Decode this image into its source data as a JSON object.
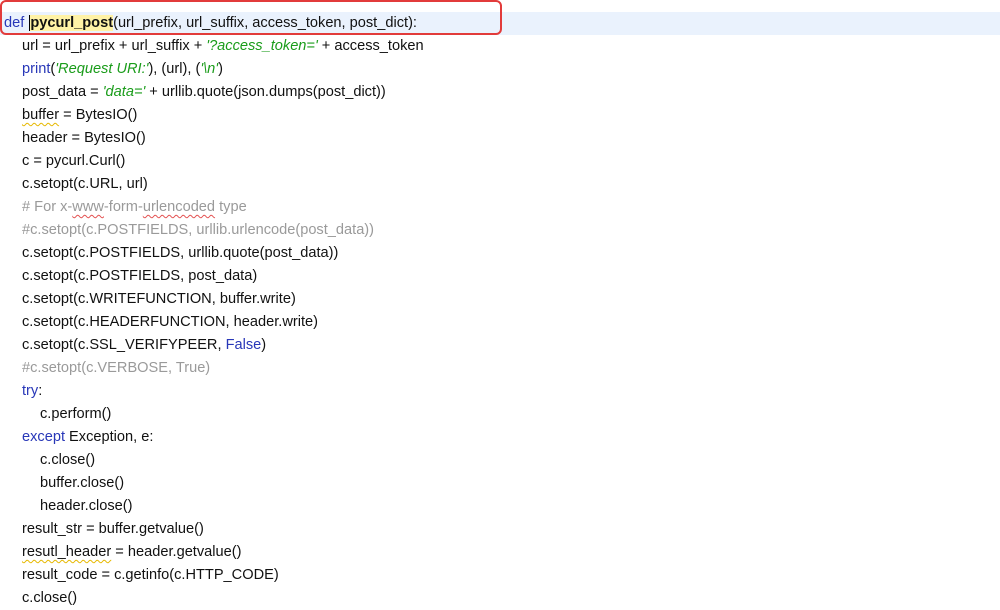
{
  "editor": {
    "language": "python",
    "colors": {
      "keyword": "#2837b8",
      "string": "#1a9c1a",
      "comment": "#9a9a9a",
      "current_line_bg": "#eaf2fd",
      "symbol_highlight": "#fff2a6",
      "annotation_box": "#e23b3b",
      "spell_warning": "#e6b800",
      "spell_error": "#e35050"
    },
    "lines": [
      {
        "indent": 0,
        "kw": "def",
        "fname": "pycurl_post",
        "rest": "(url_prefix, url_suffix, access_token, post_dict):"
      },
      {
        "indent": 1,
        "a": "url = url_prefix + url_suffix + ",
        "str": "'?access_token='",
        "b": " + access_token"
      },
      {
        "indent": 1,
        "kw": "print",
        "a": "(",
        "str": "'Request URI:'",
        "b": "), (url), (",
        "str2": "'\\n'",
        "c": ")"
      },
      {
        "indent": 1,
        "a": "post_data = ",
        "str": "'data='",
        "b": " + urllib.quote(json.dumps(post_dict))"
      },
      {
        "indent": 1,
        "warn": "buffer",
        "a": " = BytesIO()"
      },
      {
        "indent": 1,
        "a": "header = BytesIO()"
      },
      {
        "indent": 1,
        "a": "c = pycurl.Curl()"
      },
      {
        "indent": 1,
        "a": "c.setopt(c.URL, url)"
      },
      {
        "indent": 1,
        "cmt_a": "# For x-",
        "cmt_err1": "www",
        "cmt_b": "-form-",
        "cmt_err2": "urlencoded",
        "cmt_c": " type"
      },
      {
        "indent": 1,
        "cmt": "#c.setopt(c.POSTFIELDS, urllib.urlencode(post_data))"
      },
      {
        "indent": 1,
        "a": "c.setopt(c.POSTFIELDS, urllib.quote(post_data))"
      },
      {
        "indent": 1,
        "a": "c.setopt(c.POSTFIELDS, post_data)"
      },
      {
        "indent": 1,
        "a": "c.setopt(c.WRITEFUNCTION, buffer.write)"
      },
      {
        "indent": 1,
        "a": "c.setopt(c.HEADERFUNCTION, header.write)"
      },
      {
        "indent": 1,
        "a": "c.setopt(c.SSL_VERIFYPEER, ",
        "const": "False",
        "b": ")"
      },
      {
        "indent": 1,
        "cmt": "#c.setopt(c.VERBOSE, True)"
      },
      {
        "indent": 1,
        "kw": "try",
        "a": ":"
      },
      {
        "indent": 2,
        "a": "c.perform()"
      },
      {
        "indent": 1,
        "kw": "except",
        "a": " Exception, e:"
      },
      {
        "indent": 2,
        "a": "c.close()"
      },
      {
        "indent": 2,
        "a": "buffer.close()"
      },
      {
        "indent": 2,
        "a": "header.close()"
      },
      {
        "indent": 1,
        "a": "result_str = buffer.getvalue()"
      },
      {
        "indent": 1,
        "warn": "resutl_header",
        "a": " = header.getvalue()"
      },
      {
        "indent": 1,
        "a": "result_code = c.getinfo(c.HTTP_CODE)"
      },
      {
        "indent": 1,
        "a": "c.close()"
      }
    ]
  }
}
